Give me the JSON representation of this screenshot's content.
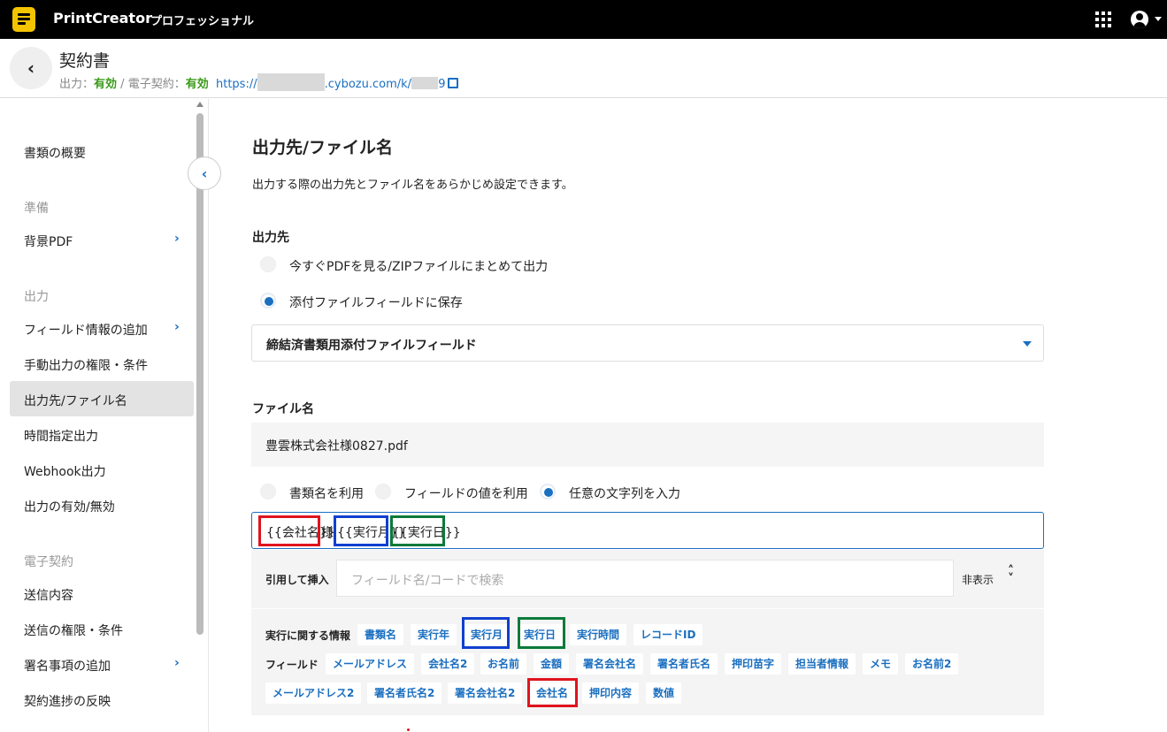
{
  "topbar": {
    "app_name": "PrintCreator",
    "edition": "プロフェッショナル",
    "logo_color": "#f5c400"
  },
  "header": {
    "title": "契約書",
    "output_label": "出力：",
    "output_value": "有効",
    "sep": " / ",
    "esign_label": "電子契約：",
    "esign_value": "有効",
    "url_prefix": "https://",
    "url_mid": ".cybozu.com/k/1",
    "url_suffix": "9"
  },
  "sidebar": {
    "overview": "書類の概要",
    "section_prep": "準備",
    "bg_pdf": "背景PDF",
    "section_output": "出力",
    "field_add": "フィールド情報の追加",
    "manual_perm": "手動出力の権限・条件",
    "dest_filename": "出力先/ファイル名",
    "scheduled": "時間指定出力",
    "webhook": "Webhook出力",
    "enable": "出力の有効/無効",
    "section_esign": "電子契約",
    "send_content": "送信内容",
    "send_perm": "送信の権限・条件",
    "sign_add": "署名事項の追加",
    "progress": "契約進捗の反映"
  },
  "main": {
    "title": "出力先/ファイル名",
    "description": "出力する際の出力先とファイル名をあらかじめ設定できます。",
    "dest_label": "出力先",
    "dest_opt1": "今すぐPDFを見る/ZIPファイルにまとめて出力",
    "dest_opt2": "添付ファイルフィールドに保存",
    "dest_select": "締結済書類用添付ファイルフィールド",
    "filename_label": "ファイル名",
    "filename_preview": "豊雲株式会社様0827.pdf",
    "fn_opt1": "書類名を利用",
    "fn_opt2": "フィールドの値を利用",
    "fn_opt3": "任意の文字列を入力",
    "tmpl_tok1": "{{会社名}}",
    "tmpl_tok2": "様",
    "tmpl_tok3": "{{実行月}}",
    "tmpl_tok4": "{{実行日}}",
    "insert_label": "引用して挿入",
    "search_placeholder": "フィールド名/コードで検索",
    "hide": "非表示",
    "exec_info_label": "実行に関する情報",
    "field_label": "フィールド",
    "exec_chips": [
      "書類名",
      "実行年",
      "実行月",
      "実行日",
      "実行時間",
      "レコードID"
    ],
    "field_chips_row1": [
      "メールアドレス",
      "会社名2",
      "お名前",
      "金額",
      "署名会社名",
      "署名者氏名",
      "押印苗字",
      "担当者情報",
      "メモ",
      "お名前2"
    ],
    "field_chips_row2": [
      "メールアドレス2",
      "署名者氏名2",
      "署名会社名2",
      "会社名",
      "押印内容",
      "数値"
    ]
  },
  "colors": {
    "accent": "#1a6fc0",
    "ok": "#3a9a1a",
    "highlight_red": "#e0141e",
    "highlight_blue": "#1040d0",
    "highlight_green": "#0a7a3a"
  }
}
